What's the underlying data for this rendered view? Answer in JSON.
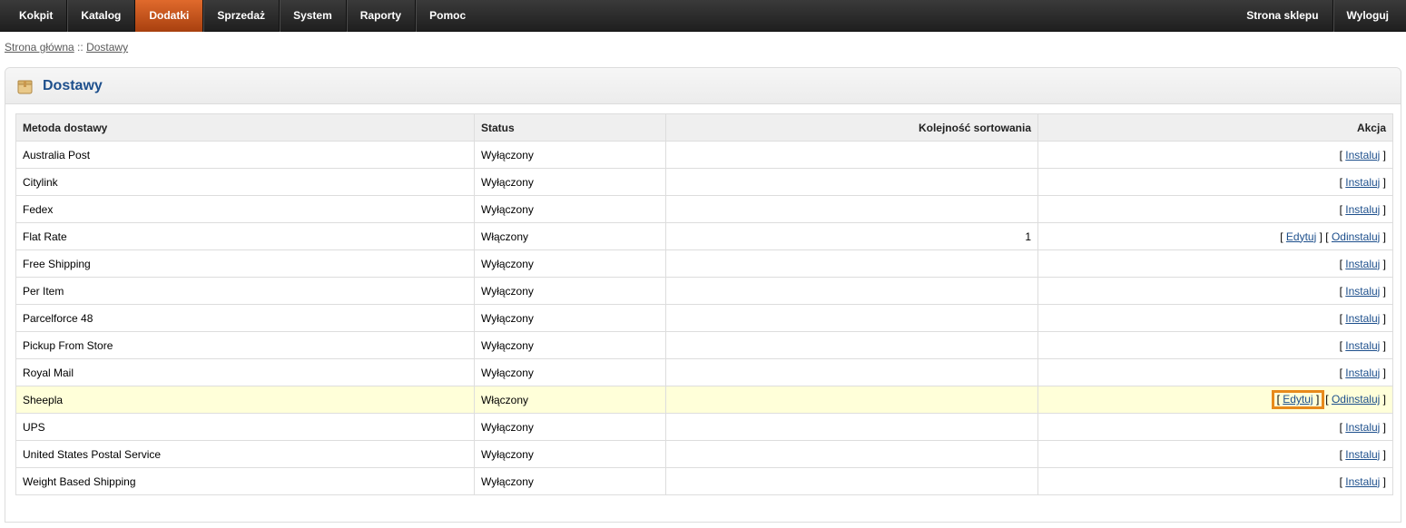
{
  "menu": {
    "left": [
      "Kokpit",
      "Katalog",
      "Dodatki",
      "Sprzedaż",
      "System",
      "Raporty",
      "Pomoc"
    ],
    "active": "Dodatki",
    "right": [
      "Strona sklepu",
      "Wyloguj"
    ]
  },
  "breadcrumb": {
    "home": "Strona główna",
    "separator": " :: ",
    "current": "Dostawy"
  },
  "box": {
    "title": "Dostawy",
    "icon": "shipping-box-icon"
  },
  "table": {
    "headers": {
      "method": "Metoda dostawy",
      "status": "Status",
      "sort_order": "Kolejność sortowania",
      "action": "Akcja"
    },
    "rows": [
      {
        "method": "Australia Post",
        "status": "Wyłączony",
        "sort_order": "",
        "actions": [
          "Instaluj"
        ]
      },
      {
        "method": "Citylink",
        "status": "Wyłączony",
        "sort_order": "",
        "actions": [
          "Instaluj"
        ]
      },
      {
        "method": "Fedex",
        "status": "Wyłączony",
        "sort_order": "",
        "actions": [
          "Instaluj"
        ]
      },
      {
        "method": "Flat Rate",
        "status": "Włączony",
        "sort_order": "1",
        "actions": [
          "Edytuj",
          "Odinstaluj"
        ]
      },
      {
        "method": "Free Shipping",
        "status": "Wyłączony",
        "sort_order": "",
        "actions": [
          "Instaluj"
        ]
      },
      {
        "method": "Per Item",
        "status": "Wyłączony",
        "sort_order": "",
        "actions": [
          "Instaluj"
        ]
      },
      {
        "method": "Parcelforce 48",
        "status": "Wyłączony",
        "sort_order": "",
        "actions": [
          "Instaluj"
        ]
      },
      {
        "method": "Pickup From Store",
        "status": "Wyłączony",
        "sort_order": "",
        "actions": [
          "Instaluj"
        ]
      },
      {
        "method": "Royal Mail",
        "status": "Wyłączony",
        "sort_order": "",
        "actions": [
          "Instaluj"
        ]
      },
      {
        "method": "Sheepla",
        "status": "Włączony",
        "sort_order": "",
        "actions": [
          "Edytuj",
          "Odinstaluj"
        ],
        "highlighted": true,
        "framed_action": "Edytuj"
      },
      {
        "method": "UPS",
        "status": "Wyłączony",
        "sort_order": "",
        "actions": [
          "Instaluj"
        ]
      },
      {
        "method": "United States Postal Service",
        "status": "Wyłączony",
        "sort_order": "",
        "actions": [
          "Instaluj"
        ]
      },
      {
        "method": "Weight Based Shipping",
        "status": "Wyłączony",
        "sort_order": "",
        "actions": [
          "Instaluj"
        ]
      }
    ]
  },
  "colors": {
    "menu_active": "#c4561c",
    "title": "#1d4f8c",
    "highlight_row": "#ffffd9",
    "annotation_frame": "#e88a1b"
  }
}
